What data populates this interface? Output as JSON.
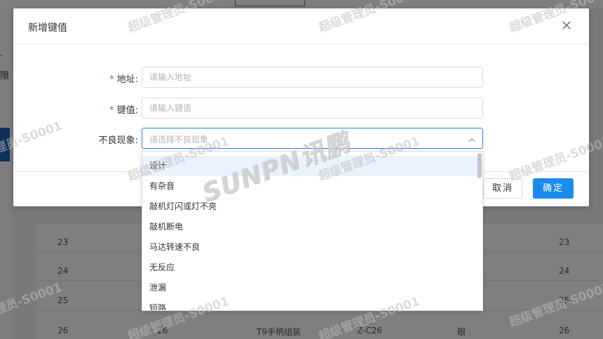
{
  "background": {
    "sidebar_fragment_1": "-",
    "sidebar_fragment_2": "限",
    "table_rows": [
      {
        "a": "23",
        "b": "",
        "c": "",
        "d": "",
        "e": "",
        "f": "23"
      },
      {
        "a": "24",
        "b": "",
        "c": "",
        "d": "",
        "e": "",
        "f": "24"
      },
      {
        "a": "25",
        "b": "",
        "c": "",
        "d": "",
        "e": "",
        "f": "25"
      },
      {
        "a": "26",
        "b": "26",
        "c": "T9手柄组装",
        "d": "Z-C26",
        "e": "眼",
        "f": "26"
      }
    ]
  },
  "modal": {
    "title": "新增键值",
    "close_label": "×",
    "fields": {
      "address": {
        "label": "地址:",
        "required_mark": "*",
        "placeholder": "请输入地址",
        "value": ""
      },
      "key_value": {
        "label": "键值:",
        "required_mark": "*",
        "placeholder": "请输入键值",
        "value": ""
      },
      "defect": {
        "label": "不良现象:",
        "placeholder": "请选择不良现象"
      }
    },
    "buttons": {
      "cancel": "取消",
      "ok": "确定"
    }
  },
  "dropdown": {
    "options": [
      "设计",
      "有杂音",
      "敲机灯闪或灯不亮",
      "敲机断电",
      "马达转速不良",
      "无反应",
      "泄漏",
      "短路"
    ],
    "highlighted_index": 0
  },
  "watermark": {
    "text": "超级管理员-S0001",
    "brand": "SUNPN讯鹏"
  },
  "colors": {
    "primary": "#1a8cf0",
    "required": "#e74c3c",
    "focus_border": "#2a7be4",
    "highlight": "#e9f2fd"
  }
}
